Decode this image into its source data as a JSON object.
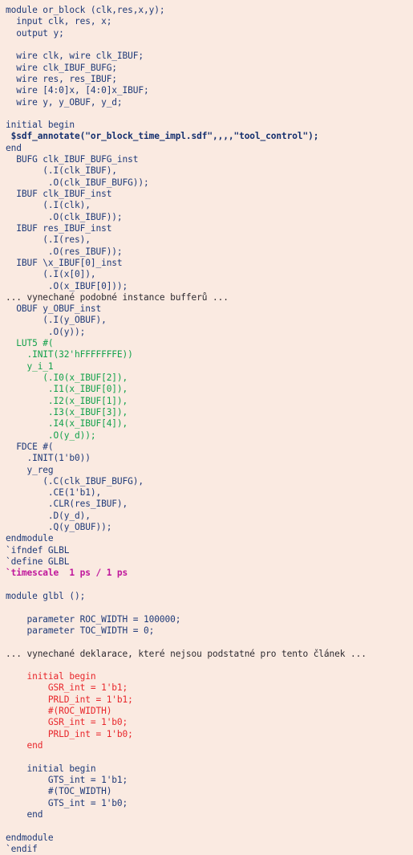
{
  "document": {
    "kind": "source-code-listing",
    "language": "Verilog",
    "background_color": "#faeae1",
    "palette": {
      "default": "#232027",
      "navy": "#1f3a79",
      "navy_bold": "#16306f",
      "green": "#12a14b",
      "red": "#e8262b",
      "magenta": "#c0179c",
      "grey": "#2d2a30"
    }
  },
  "lines": [
    {
      "text": "module or_block (clk,res,x,y);",
      "style": "navy"
    },
    {
      "text": "  input clk, res, x;",
      "style": "navy"
    },
    {
      "text": "  output y;",
      "style": "navy"
    },
    {
      "text": "",
      "style": "default"
    },
    {
      "text": "  wire clk, wire clk_IBUF;",
      "style": "navy"
    },
    {
      "text": "  wire clk_IBUF_BUFG;",
      "style": "navy"
    },
    {
      "text": "  wire res, res_IBUF;",
      "style": "navy"
    },
    {
      "text": "  wire [4:0]x, [4:0]x_IBUF;",
      "style": "navy"
    },
    {
      "text": "  wire y, y_OBUF, y_d;",
      "style": "navy"
    },
    {
      "text": "",
      "style": "default"
    },
    {
      "text": "initial begin",
      "style": "navy"
    },
    {
      "text": " $sdf_annotate(\"or_block_time_impl.sdf\",,,,\"tool_control\");",
      "style": "navy-bold"
    },
    {
      "text": "end",
      "style": "navy"
    },
    {
      "text": "  BUFG clk_IBUF_BUFG_inst",
      "style": "navy"
    },
    {
      "text": "       (.I(clk_IBUF),",
      "style": "navy"
    },
    {
      "text": "        .O(clk_IBUF_BUFG));",
      "style": "navy"
    },
    {
      "text": "  IBUF clk_IBUF_inst",
      "style": "navy"
    },
    {
      "text": "       (.I(clk),",
      "style": "navy"
    },
    {
      "text": "        .O(clk_IBUF));",
      "style": "navy"
    },
    {
      "text": "  IBUF res_IBUF_inst",
      "style": "navy"
    },
    {
      "text": "       (.I(res),",
      "style": "navy"
    },
    {
      "text": "        .O(res_IBUF));",
      "style": "navy"
    },
    {
      "text": "  IBUF \\x_IBUF[0]_inst",
      "style": "navy"
    },
    {
      "text": "       (.I(x[0]),",
      "style": "navy"
    },
    {
      "text": "        .O(x_IBUF[0]));",
      "style": "navy"
    },
    {
      "text": "... vynechané podobné instance bufferů ...",
      "style": "grey"
    },
    {
      "text": "  OBUF y_OBUF_inst",
      "style": "navy"
    },
    {
      "text": "       (.I(y_OBUF),",
      "style": "navy"
    },
    {
      "text": "        .O(y));",
      "style": "navy"
    },
    {
      "text": "  LUT5 #(",
      "style": "green"
    },
    {
      "text": "    .INIT(32'hFFFFFFFE))",
      "style": "green"
    },
    {
      "text": "    y_i_1",
      "style": "green"
    },
    {
      "text": "       (.I0(x_IBUF[2]),",
      "style": "green"
    },
    {
      "text": "        .I1(x_IBUF[0]),",
      "style": "green"
    },
    {
      "text": "        .I2(x_IBUF[1]),",
      "style": "green"
    },
    {
      "text": "        .I3(x_IBUF[3]),",
      "style": "green"
    },
    {
      "text": "        .I4(x_IBUF[4]),",
      "style": "green"
    },
    {
      "text": "        .O(y_d));",
      "style": "green"
    },
    {
      "text": "  FDCE #(",
      "style": "navy"
    },
    {
      "text": "    .INIT(1'b0))",
      "style": "navy"
    },
    {
      "text": "    y_reg",
      "style": "navy"
    },
    {
      "text": "       (.C(clk_IBUF_BUFG),",
      "style": "navy"
    },
    {
      "text": "        .CE(1'b1),",
      "style": "navy"
    },
    {
      "text": "        .CLR(res_IBUF),",
      "style": "navy"
    },
    {
      "text": "        .D(y_d),",
      "style": "navy"
    },
    {
      "text": "        .Q(y_OBUF));",
      "style": "navy"
    },
    {
      "text": "endmodule",
      "style": "navy"
    },
    {
      "text": "`ifndef GLBL",
      "style": "navy"
    },
    {
      "text": "`define GLBL",
      "style": "navy"
    },
    {
      "text": "`timescale  1 ps / 1 ps",
      "style": "magenta"
    },
    {
      "text": "",
      "style": "default"
    },
    {
      "text": "module glbl ();",
      "style": "navy"
    },
    {
      "text": "",
      "style": "default"
    },
    {
      "text": "    parameter ROC_WIDTH = 100000;",
      "style": "navy"
    },
    {
      "text": "    parameter TOC_WIDTH = 0;",
      "style": "navy"
    },
    {
      "text": "",
      "style": "default"
    },
    {
      "text": "... vynechané deklarace, které nejsou podstatné pro tento článek ...",
      "style": "grey"
    },
    {
      "text": "",
      "style": "default"
    },
    {
      "text": "    initial begin",
      "style": "red"
    },
    {
      "text": "        GSR_int = 1'b1;",
      "style": "red"
    },
    {
      "text": "        PRLD_int = 1'b1;",
      "style": "red"
    },
    {
      "text": "        #(ROC_WIDTH)",
      "style": "red"
    },
    {
      "text": "        GSR_int = 1'b0;",
      "style": "red"
    },
    {
      "text": "        PRLD_int = 1'b0;",
      "style": "red"
    },
    {
      "text": "    end",
      "style": "red"
    },
    {
      "text": "",
      "style": "default"
    },
    {
      "text": "    initial begin",
      "style": "navy"
    },
    {
      "text": "        GTS_int = 1'b1;",
      "style": "navy"
    },
    {
      "text": "        #(TOC_WIDTH)",
      "style": "navy"
    },
    {
      "text": "        GTS_int = 1'b0;",
      "style": "navy"
    },
    {
      "text": "    end",
      "style": "navy"
    },
    {
      "text": "",
      "style": "default"
    },
    {
      "text": "endmodule",
      "style": "navy"
    },
    {
      "text": "`endif",
      "style": "navy"
    }
  ]
}
